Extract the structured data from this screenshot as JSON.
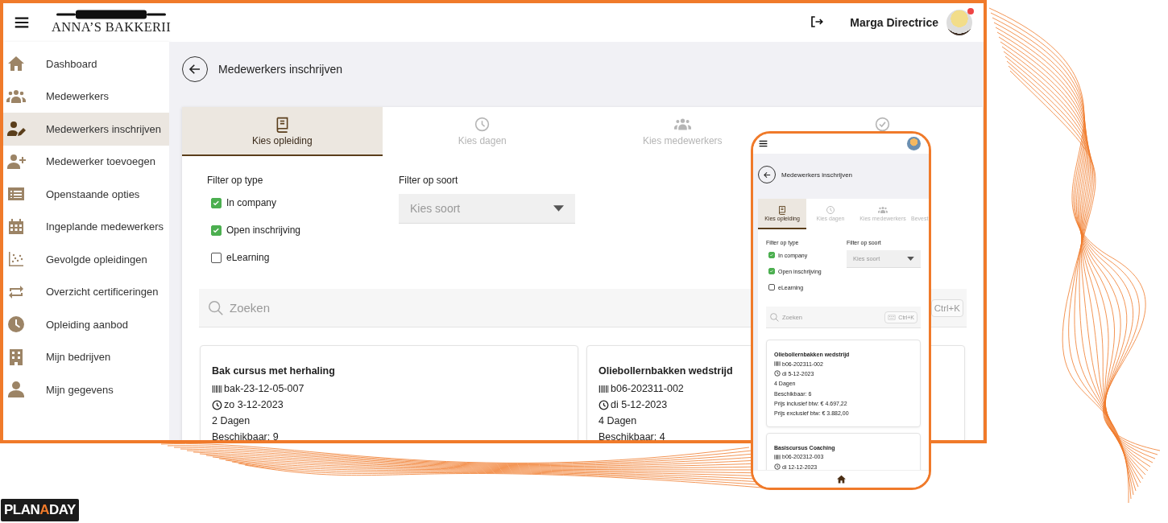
{
  "header": {
    "logo_text": "ANNA’S BAKKERII",
    "user_name": "Marga Directrice",
    "notification": true
  },
  "sidebar": {
    "items": [
      {
        "label": "Dashboard",
        "selected": false
      },
      {
        "label": "Medewerkers",
        "selected": false
      },
      {
        "label": "Medewerkers inschrijven",
        "selected": true
      },
      {
        "label": "Medewerker toevoegen",
        "selected": false
      },
      {
        "label": "Openstaande opties",
        "selected": false
      },
      {
        "label": "Ingeplande medewerkers",
        "selected": false
      },
      {
        "label": "Gevolgde opleidingen",
        "selected": false
      },
      {
        "label": "Overzicht certificeringen",
        "selected": false
      },
      {
        "label": "Opleiding aanbod",
        "selected": false
      },
      {
        "label": "Mijn bedrijven",
        "selected": false
      },
      {
        "label": "Mijn gegevens",
        "selected": false
      }
    ]
  },
  "page": {
    "title": "Medewerkers inschrijven",
    "steps": [
      {
        "label": "Kies opleiding",
        "selected": true
      },
      {
        "label": "Kies dagen",
        "selected": false
      },
      {
        "label": "Kies medewerkers",
        "selected": false
      },
      {
        "selected": false
      }
    ],
    "filters": {
      "type_label": "Filter op type",
      "options": [
        {
          "label": "In company",
          "checked": true
        },
        {
          "label": "Open inschrijving",
          "checked": true
        },
        {
          "label": "eLearning",
          "checked": false
        }
      ],
      "sort_label": "Filter op soort",
      "sort_placeholder": "Kies soort"
    },
    "search": {
      "placeholder": "Zoeken",
      "shortcut": "Ctrl+K"
    },
    "courses": [
      {
        "title": "Bak cursus met herhaling",
        "code": "bak-23-12-05-007",
        "date": "zo 3-12-2023",
        "days": "2 Dagen",
        "available": "Beschikbaar: 9"
      },
      {
        "title": "Oliebollernbakken wedstrijd",
        "code": "b06-202311-002",
        "date": "di 5-12-2023",
        "days": "4 Dagen",
        "available": "Beschikbaar: 4"
      }
    ]
  },
  "mobile": {
    "title": "Medewerkers inschrijven",
    "steps": [
      {
        "label": "Kies opleiding",
        "selected": true
      },
      {
        "label": "Kies dagen",
        "selected": false
      },
      {
        "label": "Kies medewerkers",
        "selected": false
      },
      {
        "label": "Bevest",
        "selected": false
      }
    ],
    "filters": {
      "type_label": "Filter op type",
      "options": [
        {
          "label": "In company",
          "checked": true
        },
        {
          "label": "Open inschrijving",
          "checked": true
        },
        {
          "label": "eLearning",
          "checked": false
        }
      ],
      "sort_label": "Filter op soort",
      "sort_placeholder": "Kies soort"
    },
    "search": {
      "placeholder": "Zoeken",
      "shortcut": "Ctrl+K"
    },
    "courses": [
      {
        "title": "Oliebollernbakken wedstrijd",
        "code": "b06-202311-002",
        "date": "di 5-12-2023",
        "days": "4 Dagen",
        "available": "Beschikbaar: 6",
        "price_incl": "Prijs inclusief btw: € 4.697,22",
        "price_excl": "Prijs exclusief btw: € 3.882,00"
      },
      {
        "title": "Basiscursus Coaching",
        "code": "b06-202312-003",
        "date": "di 12-12-2023"
      }
    ]
  },
  "brand": {
    "parts": [
      "PLAN",
      "A",
      "DAY"
    ]
  }
}
